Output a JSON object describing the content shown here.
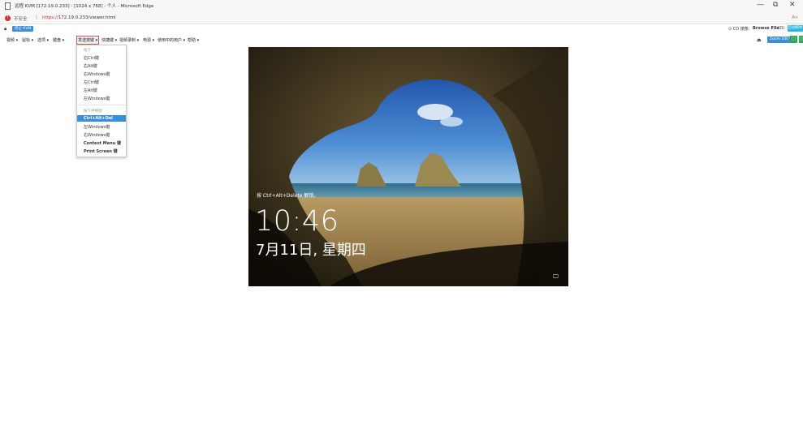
{
  "browser": {
    "window_title": "远程 KVM [172.19.0.233] - [1024 x 768] - 个人 - Microsoft Edge",
    "insecure_label": "不安全",
    "url_scheme": "https://",
    "url_rest": "172.19.0.233/viewer.html",
    "controls": {
      "minimize": "—",
      "restore": "⧉",
      "close": "✕"
    },
    "reader_icon": "read-aloud-icon"
  },
  "kvm_bar": {
    "stop_label": "停止 KVM",
    "cd_label": "CD 镜像:",
    "browse_label": "Browse File",
    "file_size": "(0 KB)",
    "start_label": "启动媒体",
    "lock_icon": "lock-icon"
  },
  "menu": {
    "items": [
      "视频 ▾",
      "鼠标 ▾",
      "选项 ▾",
      "键盘 ▾",
      "发送按键 ▾",
      "快捷键 ▾",
      "视频录制 ▾",
      "电源 ▾",
      "使用中的用户 ▾",
      "帮助 ▾"
    ],
    "zoom_label": "Zoom 100 %",
    "eject_icon": "eject-icon"
  },
  "dropdown": {
    "hold_header": "按下",
    "hold_items": [
      "右Ctrl键",
      "右Alt键",
      "右Windows键",
      "左Ctrl键",
      "左Alt键",
      "左Windows键"
    ],
    "press_header": "按下并释放",
    "press_items": [
      "Ctrl+Alt+Del",
      "左Windows键",
      "右Windows键",
      "Context Menu 键",
      "Print Screen 键"
    ]
  },
  "lockscreen": {
    "hint": "按 Ctrl+Alt+Delete 解锁。",
    "time": "10:46",
    "date": "7月11日, 星期四",
    "ease_icon": "ease-of-access-icon"
  },
  "colors": {
    "accent": "#3a8fd9",
    "active_menu_border": "#d9534f",
    "start_button": "#27b7e6",
    "green_button": "#2aa952",
    "insecure": "#d93025"
  }
}
